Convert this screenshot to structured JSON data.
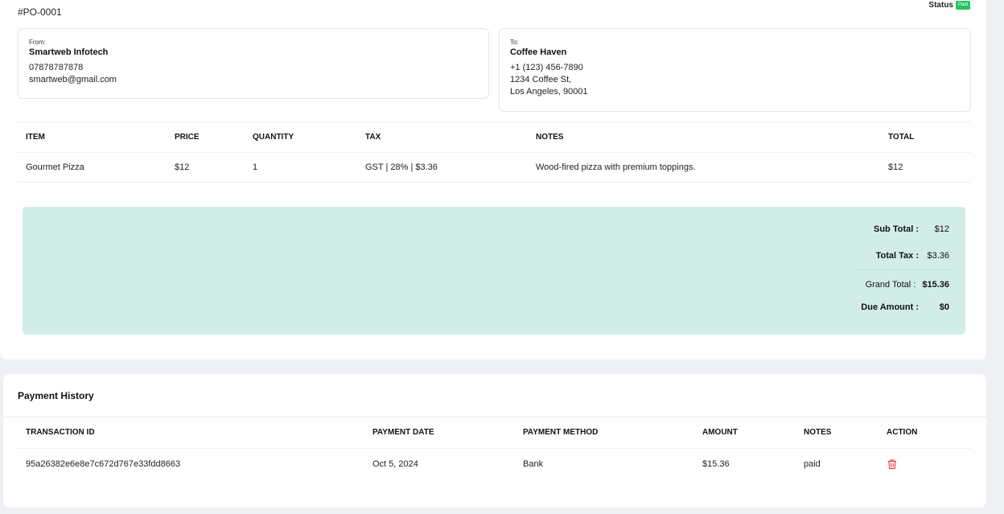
{
  "order": {
    "number": "#PO-0001",
    "status_label": "Status",
    "status_value": "Paid",
    "status_color": "#22c55e"
  },
  "from": {
    "label": "From:",
    "name": "Smartweb Infotech",
    "phone": "07878787878",
    "email": "smartweb@gmail.com"
  },
  "to": {
    "label": "To:",
    "name": "Coffee Haven",
    "phone": "+1 (123) 456-7890",
    "address1": "1234 Coffee St,",
    "address2": "Los Angeles, 90001"
  },
  "items": {
    "headers": [
      "ITEM",
      "PRICE",
      "QUANTITY",
      "TAX",
      "NOTES",
      "TOTAL"
    ],
    "rows": [
      {
        "item": "Gourmet Pizza",
        "price": "$12",
        "quantity": "1",
        "tax": "GST | 28% | $3.36",
        "notes": "Wood-fired pizza with premium toppings.",
        "total": "$12"
      }
    ]
  },
  "summary": {
    "sub_total_label": "Sub Total :",
    "sub_total": "$12",
    "total_tax_label": "Total Tax :",
    "total_tax": "$3.36",
    "grand_total_label": "Grand Total :",
    "grand_total": "$15.36",
    "due_label": "Due Amount :",
    "due": "$0",
    "bg_color": "#d2ede8"
  },
  "payments": {
    "title": "Payment History",
    "headers": [
      "TRANSACTION ID",
      "PAYMENT DATE",
      "PAYMENT METHOD",
      "AMOUNT",
      "NOTES",
      "ACTION"
    ],
    "rows": [
      {
        "transaction_id": "95a26382e6e8e7c672d767e33fdd8663",
        "date": "Oct 5, 2024",
        "method": "Bank",
        "amount": "$15.36",
        "notes": "paid",
        "action_icon": "trash-icon"
      }
    ],
    "delete_color": "#ef4444"
  }
}
